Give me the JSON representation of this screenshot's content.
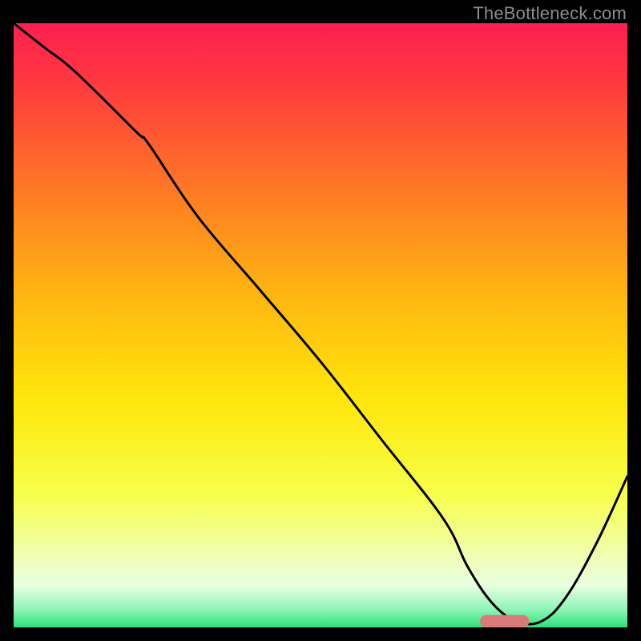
{
  "watermark": "TheBottleneck.com",
  "chart_data": {
    "type": "line",
    "title": "",
    "xlabel": "",
    "ylabel": "",
    "xlim": [
      0,
      100
    ],
    "ylim": [
      0,
      100
    ],
    "series": [
      {
        "name": "curve",
        "x": [
          0,
          5,
          10,
          20,
          22,
          30,
          40,
          50,
          60,
          70,
          74,
          78,
          82,
          86,
          90,
          95,
          100
        ],
        "values": [
          100,
          96,
          92,
          82,
          80,
          68,
          56,
          44,
          31,
          18,
          10,
          4,
          1,
          1,
          5,
          14,
          25
        ]
      }
    ],
    "marker": {
      "x_start": 76,
      "x_end": 84,
      "y": 1
    },
    "gradient_stops": [
      {
        "offset": 0.0,
        "color": "#ff1e52"
      },
      {
        "offset": 0.1,
        "color": "#ff3a3e"
      },
      {
        "offset": 0.28,
        "color": "#ff7a24"
      },
      {
        "offset": 0.45,
        "color": "#ffb610"
      },
      {
        "offset": 0.62,
        "color": "#ffe60a"
      },
      {
        "offset": 0.78,
        "color": "#f7ff4a"
      },
      {
        "offset": 0.88,
        "color": "#f0ffb0"
      },
      {
        "offset": 0.93,
        "color": "#e8ffe0"
      },
      {
        "offset": 0.97,
        "color": "#90f5b8"
      },
      {
        "offset": 1.0,
        "color": "#2de07a"
      }
    ],
    "marker_color": "#d97a7a",
    "curve_color": "#000000"
  }
}
